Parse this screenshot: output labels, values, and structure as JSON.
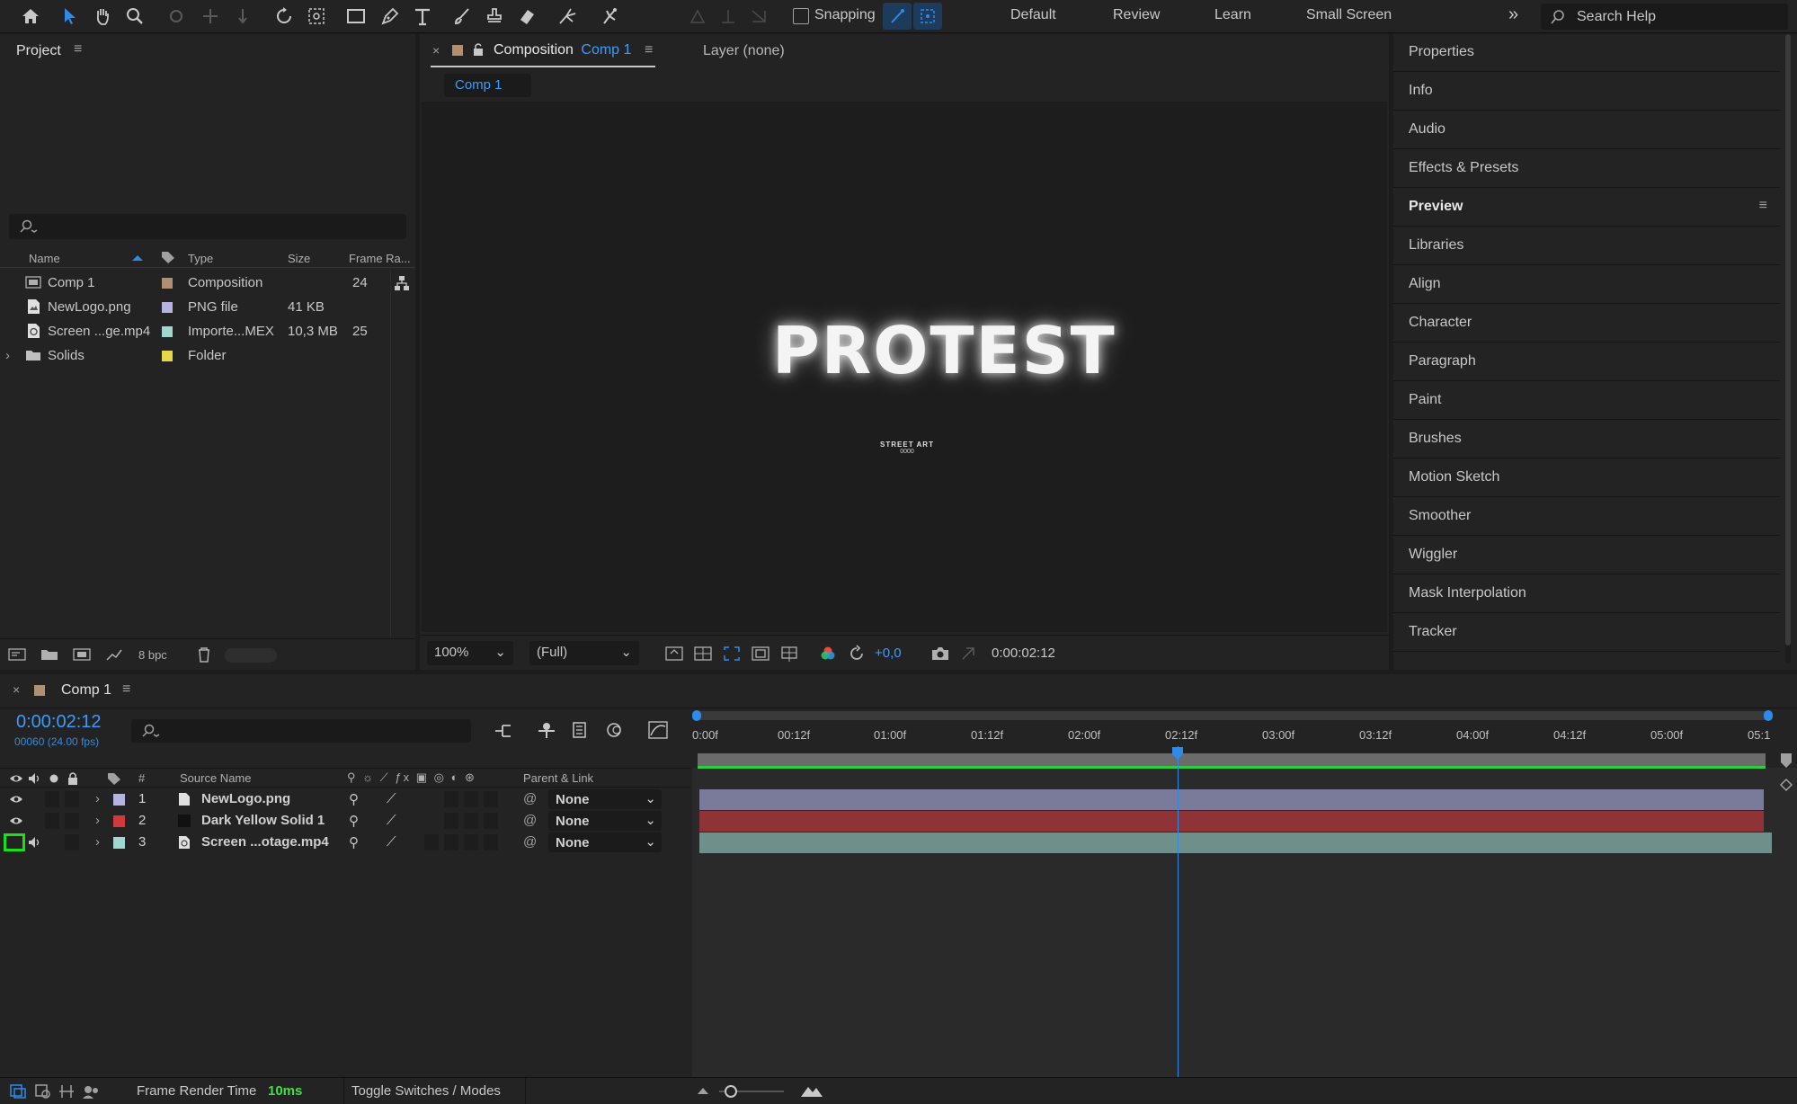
{
  "toolbar": {
    "snapping_label": "Snapping",
    "workspaces": [
      "Default",
      "Review",
      "Learn",
      "Small Screen"
    ],
    "search_placeholder": "Search Help"
  },
  "project": {
    "title": "Project",
    "columns": {
      "name": "Name",
      "type": "Type",
      "size": "Size",
      "frame_rate": "Frame Ra..."
    },
    "items": [
      {
        "name": "Comp 1",
        "type": "Composition",
        "size": "",
        "frame_rate": "24",
        "color": "#b09070",
        "icon": "composition-icon"
      },
      {
        "name": "NewLogo.png",
        "type": "PNG file",
        "size": "41 KB",
        "frame_rate": "",
        "color": "#b4b4e0",
        "icon": "image-file-icon"
      },
      {
        "name": "Screen ...ge.mp4",
        "type": "Importe...MEX",
        "size": "10,3 MB",
        "frame_rate": "25",
        "color": "#a0d8d0",
        "icon": "video-file-icon"
      },
      {
        "name": "Solids",
        "type": "Folder",
        "size": "",
        "frame_rate": "",
        "color": "#e6d84a",
        "icon": "folder-icon"
      }
    ],
    "bpc": "8 bpc"
  },
  "viewer": {
    "tab_label": "Composition",
    "tab_comp": "Comp 1",
    "layer_tab": "Layer (none)",
    "comp_pill": "Comp 1",
    "logo_text": "PROTEST",
    "logo_subtext": "STREET ART",
    "logo_subtext2": "0000",
    "zoom": "100%",
    "resolution": "(Full)",
    "exposure": "+0,0",
    "timecode": "0:00:02:12"
  },
  "right_panel": {
    "items": [
      "Properties",
      "Info",
      "Audio",
      "Effects & Presets",
      "Preview",
      "Libraries",
      "Align",
      "Character",
      "Paragraph",
      "Paint",
      "Brushes",
      "Motion Sketch",
      "Smoother",
      "Wiggler",
      "Mask Interpolation",
      "Tracker"
    ],
    "active": "Preview"
  },
  "timeline": {
    "comp_name": "Comp 1",
    "timecode": "0:00:02:12",
    "frame_info": "00060 (24.00 fps)",
    "col_num": "#",
    "col_source": "Source Name",
    "col_parent": "Parent & Link",
    "ruler": [
      "0:00f",
      "00:12f",
      "01:00f",
      "01:12f",
      "02:00f",
      "02:12f",
      "03:00f",
      "03:12f",
      "04:00f",
      "04:12f",
      "05:00f",
      "05:1"
    ],
    "playhead_time": "02:12f",
    "layers": [
      {
        "num": "1",
        "name": "NewLogo.png",
        "color": "#b4b4e0",
        "parent": "None",
        "bar_color": "#7a7a9a"
      },
      {
        "num": "2",
        "name": "Dark Yellow Solid 1",
        "color": "#d03a3a",
        "parent": "None",
        "bar_color": "#8f3336"
      },
      {
        "num": "3",
        "name": "Screen ...otage.mp4",
        "color": "#a0d8d0",
        "parent": "None",
        "bar_color": "#6f8f8a"
      }
    ]
  },
  "status": {
    "render_label": "Frame Render Time",
    "render_value": "10ms",
    "toggle_label": "Toggle Switches / Modes"
  }
}
